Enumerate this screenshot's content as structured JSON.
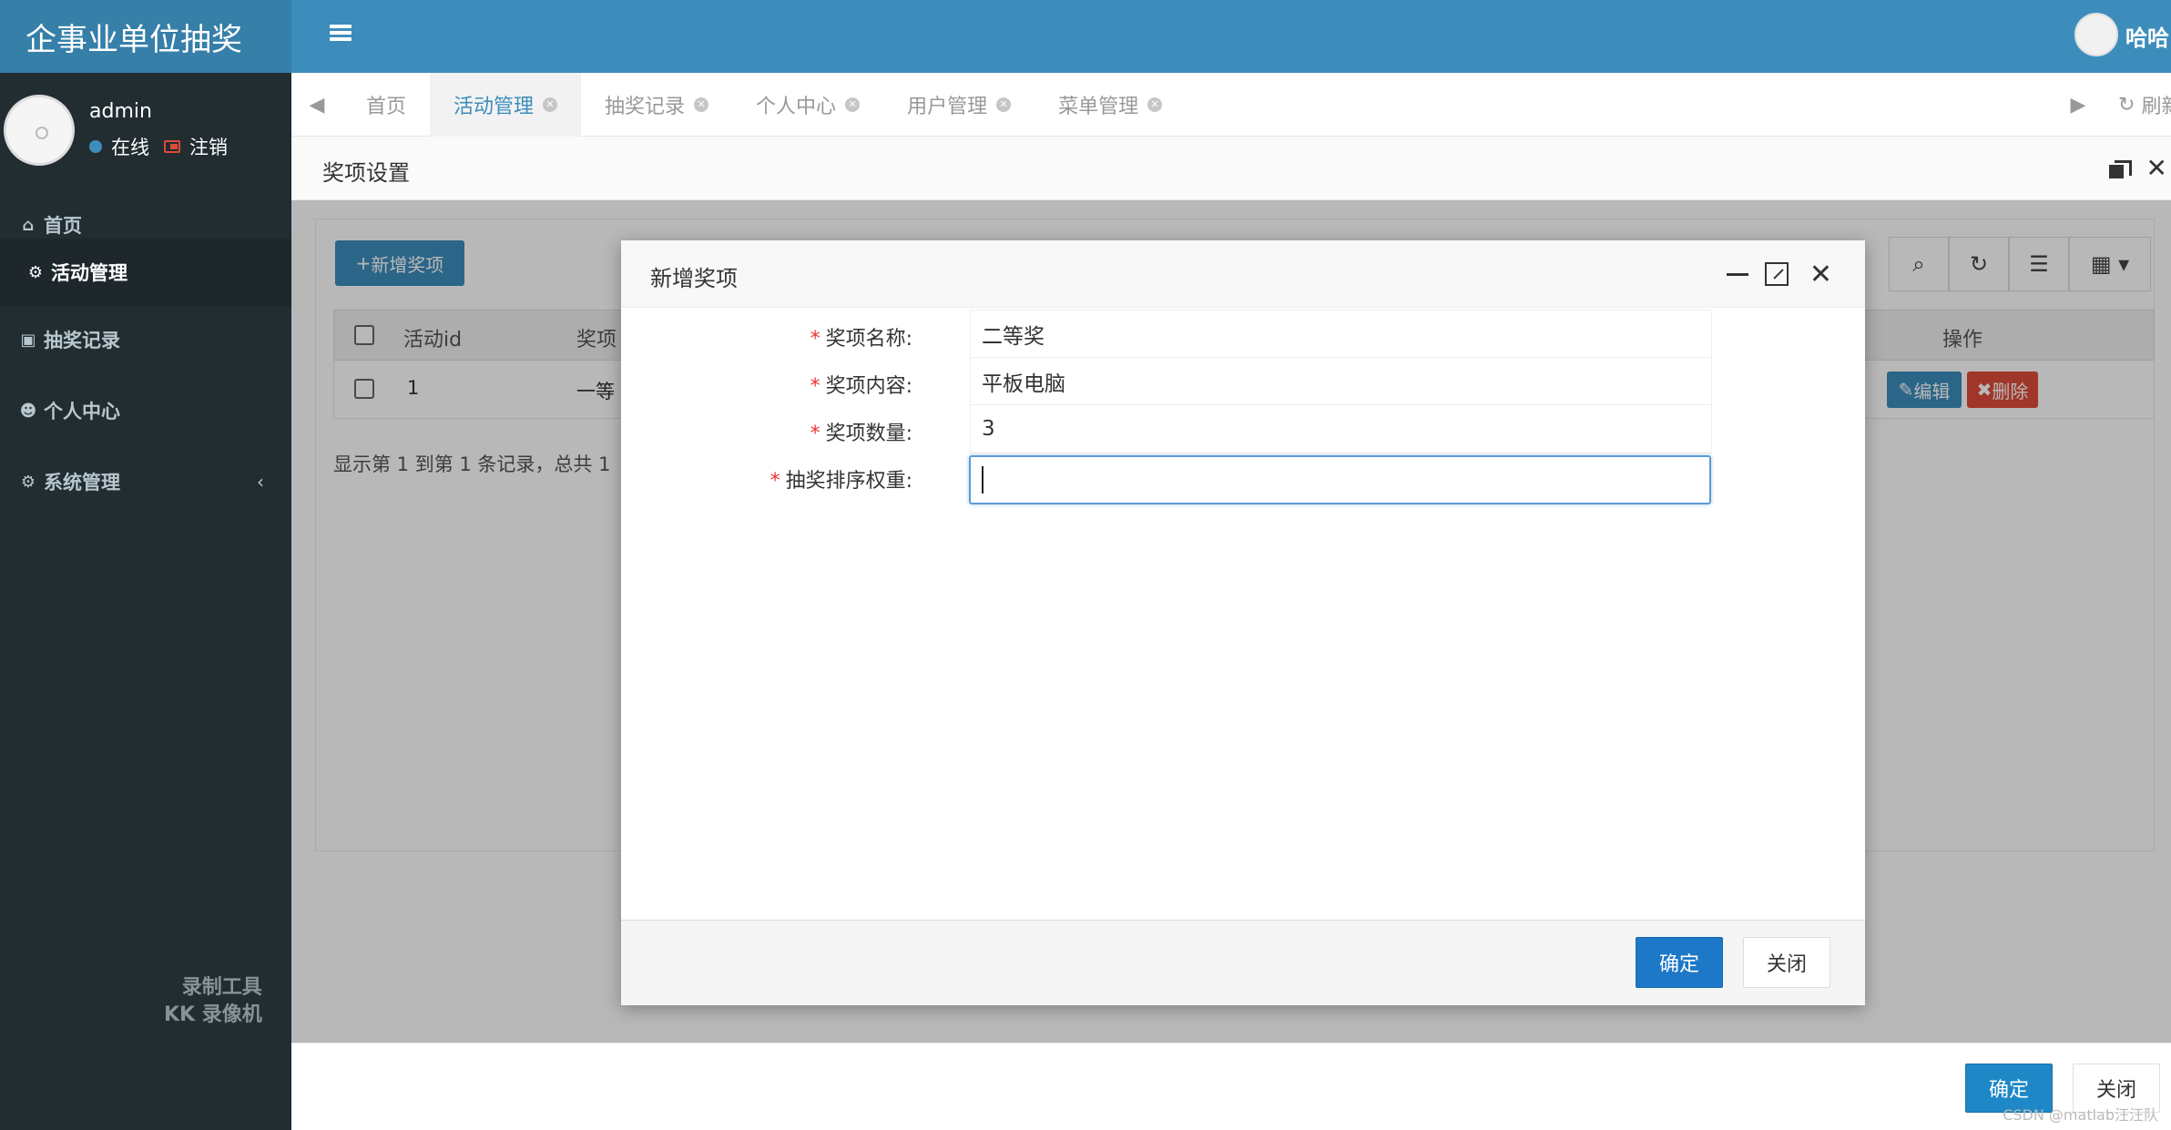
{
  "app": {
    "title": "企事业单位抽奖",
    "top_user": "哈哈"
  },
  "sidebar": {
    "user": {
      "name": "admin",
      "status": "在线",
      "logout": "注销"
    },
    "items": [
      {
        "label": "首页",
        "icon": "home-icon"
      },
      {
        "label": "活动管理",
        "icon": "cogs-icon"
      },
      {
        "label": "抽奖记录",
        "icon": "calendar-check-icon"
      },
      {
        "label": "个人中心",
        "icon": "users-icon"
      },
      {
        "label": "系统管理",
        "icon": "gear-icon"
      }
    ],
    "watermark": [
      "录制工具",
      "KK 录像机"
    ]
  },
  "tabs": {
    "items": [
      "首页",
      "活动管理",
      "抽奖记录",
      "个人中心",
      "用户管理",
      "菜单管理"
    ],
    "active": "活动管理",
    "refresh": "刷新"
  },
  "outer_window": {
    "title": "奖项设置",
    "ok_label": "确定",
    "cancel_label": "关闭"
  },
  "content": {
    "add_button": "新增奖项",
    "columns": [
      "活动id",
      "奖项",
      "操作"
    ],
    "rows": [
      {
        "activity_id": "1",
        "prize": "一等"
      }
    ],
    "edit_label": "编辑",
    "delete_label": "删除",
    "pager_text": "显示第 1 到第 1 条记录，总共 1"
  },
  "modal": {
    "title": "新增奖项",
    "fields": [
      {
        "label": "奖项名称:",
        "value": "二等奖"
      },
      {
        "label": "奖项内容:",
        "value": "平板电脑"
      },
      {
        "label": "奖项数量:",
        "value": "3"
      },
      {
        "label": "抽奖排序权重:",
        "value": ""
      }
    ],
    "ok_label": "确定",
    "cancel_label": "关闭"
  },
  "watermark_csdn": "CSDN @matlab汪汪队"
}
